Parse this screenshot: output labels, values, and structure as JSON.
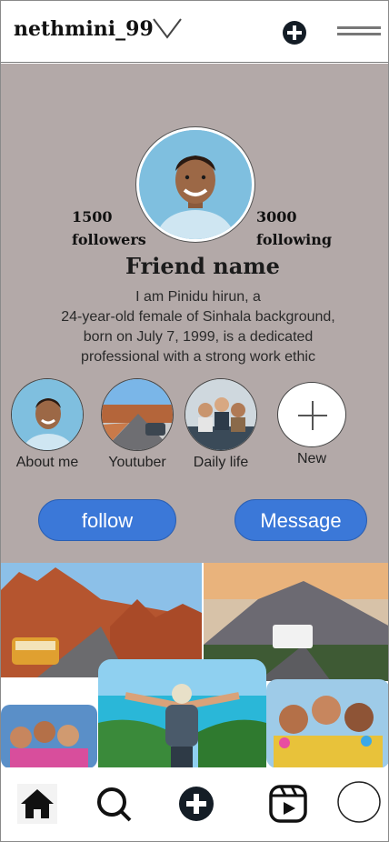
{
  "header": {
    "username": "nethmini_99"
  },
  "profile": {
    "followers_count": "1500",
    "followers_label": "followers",
    "following_count": "3000",
    "following_label": "following",
    "name": "Friend name",
    "bio_lines": [
      "I am Pinidu hirun, a",
      "24-year-old female of Sinhala background,",
      "born on July 7, 1999, is a dedicated",
      "professional with a strong work ethic"
    ]
  },
  "highlights": [
    {
      "label": "About me"
    },
    {
      "label": "Youtuber"
    },
    {
      "label": "Daily life"
    },
    {
      "label": "New"
    }
  ],
  "actions": {
    "follow_label": "follow",
    "message_label": "Message"
  },
  "colors": {
    "profile_bg": "#b3a9a8",
    "button_blue": "#3b78d8"
  },
  "icons": {
    "dropdown": "chevron-down-icon",
    "create": "plus-circle-icon",
    "menu": "menu-icon",
    "home": "home-icon",
    "search": "search-icon",
    "reels": "reels-icon",
    "profile": "profile-circle-icon"
  }
}
